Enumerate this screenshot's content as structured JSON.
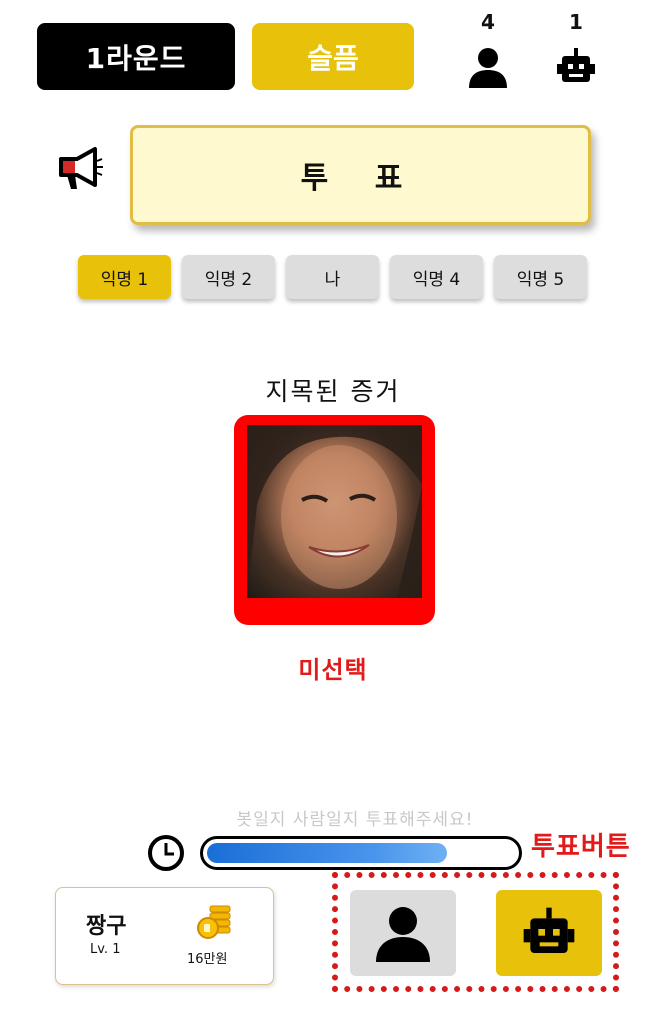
{
  "header": {
    "round_label": "1라운드",
    "mood_label": "슬픔",
    "human_count": "4",
    "bot_count": "1"
  },
  "phase": {
    "title": "투 표"
  },
  "players": [
    {
      "label": "익명 1",
      "active": true
    },
    {
      "label": "익명 2",
      "active": false
    },
    {
      "label": "나",
      "active": false
    },
    {
      "label": "익명 4",
      "active": false
    },
    {
      "label": "익명 5",
      "active": false
    }
  ],
  "evidence": {
    "title": "지목된 증거"
  },
  "selection_status": "미선택",
  "timer": {
    "prompt": "봇일지 사람일지 투표해주세요!",
    "progress": 0.78
  },
  "annotation": {
    "vote_buttons_label": "투표버튼"
  },
  "profile": {
    "name": "짱구",
    "level": "Lv. 1",
    "money": "16만원"
  },
  "colors": {
    "accent": "#e8c10a",
    "alert": "#e21a1a",
    "timer": "#1a6ed8"
  },
  "icons": {
    "human": "person-icon",
    "bot": "robot-icon",
    "phase": "megaphone-icon",
    "timer": "clock-icon",
    "money": "coin-stack-icon"
  }
}
